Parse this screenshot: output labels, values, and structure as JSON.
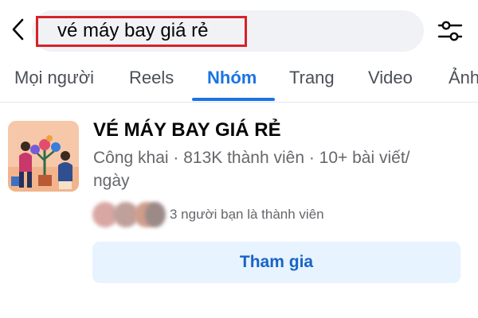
{
  "search": {
    "query": "vé máy bay giá rẻ"
  },
  "tabs": [
    {
      "label": "Mọi người"
    },
    {
      "label": "Reels"
    },
    {
      "label": "Nhóm",
      "active": true
    },
    {
      "label": "Trang"
    },
    {
      "label": "Video"
    },
    {
      "label": "Ảnh"
    }
  ],
  "group": {
    "name": "VÉ MÁY BAY GIÁ RẺ",
    "meta_line1": "Công khai · 813K thành viên · 10+ bài viết/",
    "meta_line2": "ngày",
    "friends_text": "3 người bạn là thành viên",
    "join_label": "Tham gia"
  },
  "colors": {
    "accent": "#1b74e4",
    "highlight_border": "#d6222a",
    "join_bg": "#e7f3ff"
  },
  "icons": [
    "back-arrow-icon",
    "filter-sliders-icon"
  ]
}
